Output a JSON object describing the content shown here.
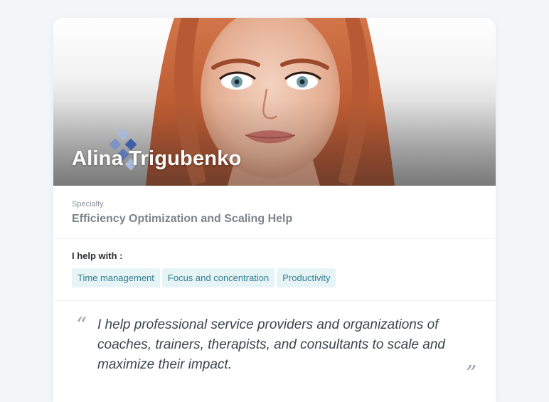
{
  "profile": {
    "name": "Alina Trigubenko",
    "specialty_label": "Specialty",
    "specialty_value": "Efficiency Optimization and Scaling Help",
    "help_label": "I help with :",
    "help_tags": [
      "Time management",
      "Focus and concentration",
      "Productivity"
    ],
    "quote_open": "“",
    "quote_close": "”",
    "quote_text": " I help professional service providers and organizations of coaches, trainers, therapists, and consultants to scale and maximize their impact."
  },
  "colors": {
    "hair": "#c8643a",
    "tag_bg": "#e7f4f6",
    "tag_text": "#2f7f8f",
    "diamond_dark": "#3f5fa8",
    "diamond_light": "#a9b9da"
  },
  "icons": {
    "portrait": "profile-portrait-image",
    "decor": "diamond-pattern-icon"
  }
}
